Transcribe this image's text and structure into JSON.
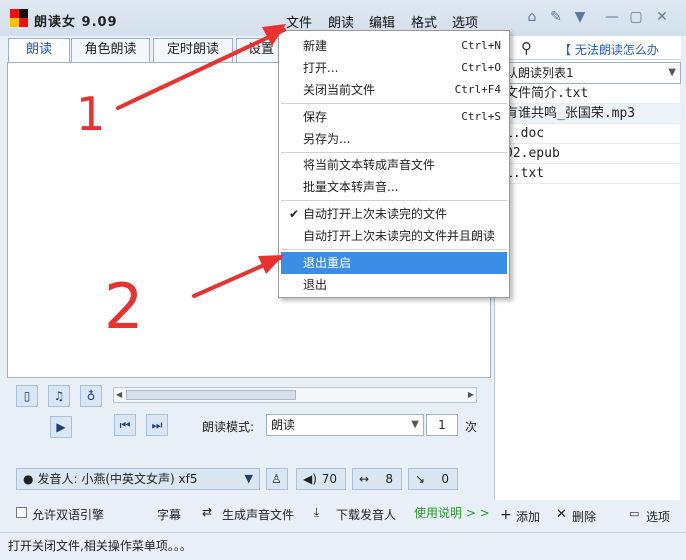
{
  "app": {
    "title": "朗读女 9.09"
  },
  "menubar": [
    "文件",
    "朗读",
    "编辑",
    "格式",
    "选项"
  ],
  "window_buttons": [
    "home-icon",
    "tools-icon",
    "shirt-icon",
    "minimize-icon",
    "maximize-icon",
    "close-icon"
  ],
  "tabs": [
    "朗读",
    "角色朗读",
    "定时朗读",
    "设置"
  ],
  "right_panel": {
    "help_link": "【 无法朗读怎么办",
    "list_name": "认朗读列表1",
    "files": [
      "文件简介.txt",
      "有谁共鸣_张国荣.mp3",
      "1.doc",
      "02.epub",
      "1.txt"
    ],
    "footer": {
      "add": "添加",
      "delete": "删除",
      "options": "选项"
    }
  },
  "controls": {
    "mode_label": "朗读模式:",
    "mode_value": "朗读",
    "times_value": "1",
    "times_unit": "次",
    "voice": "发音人: 小燕(中英文女声) xf5",
    "volume": "70",
    "speed": "8",
    "pitch": "0"
  },
  "bottom": {
    "bilingual": "允许双语引擎",
    "subtitle": "字幕",
    "generate_audio": "生成声音文件",
    "download_voice": "下载发音人",
    "instructions": "使用说明 > >"
  },
  "status": "打开关闭文件,相关操作菜单项。。。",
  "file_menu": {
    "items": [
      {
        "label": "新建",
        "shortcut": "Ctrl+N"
      },
      {
        "label": "打开...",
        "shortcut": "Ctrl+O"
      },
      {
        "label": "关闭当前文件",
        "shortcut": "Ctrl+F4"
      },
      {
        "label": "保存",
        "shortcut": "Ctrl+S"
      },
      {
        "label": "另存为...",
        "shortcut": ""
      },
      {
        "label": "将当前文本转成声音文件",
        "shortcut": ""
      },
      {
        "label": "批量文本转声音...",
        "shortcut": ""
      },
      {
        "label": "自动打开上次未读完的文件",
        "shortcut": "",
        "checked": true
      },
      {
        "label": "自动打开上次未读完的文件并且朗读",
        "shortcut": ""
      },
      {
        "label": "退出重启",
        "shortcut": "",
        "highlighted": true
      },
      {
        "label": "退出",
        "shortcut": ""
      }
    ]
  },
  "annotations": {
    "label_1": "1",
    "label_2": "2"
  },
  "colors": {
    "accent": "#3a8ee6",
    "arrow": "#e8322f",
    "link": "#1f5ed6",
    "green_link": "#2a9a2a"
  }
}
